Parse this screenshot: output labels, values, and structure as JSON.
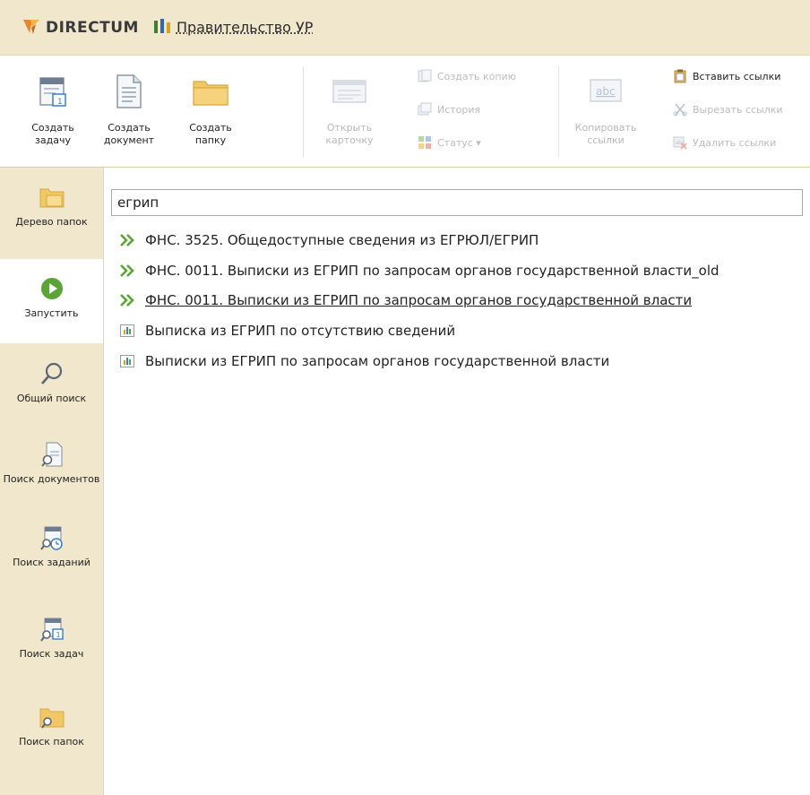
{
  "titlebar": {
    "brand": "DIRECTUM",
    "org": "Правительство УР"
  },
  "ribbon": {
    "create_task": "Создать задачу",
    "create_document": "Создать документ",
    "create_folder": "Создать папку",
    "open_card": "Открыть карточку",
    "create_copy": "Создать копию",
    "history": "История",
    "status": "Статус ▾",
    "copy_links": "Копировать ссылки",
    "paste_links": "Вставить ссылки",
    "cut_links": "Вырезать ссылки",
    "delete_links": "Удалить ссылки"
  },
  "sidebar": {
    "items": [
      {
        "label": "Дерево папок"
      },
      {
        "label": "Запустить"
      },
      {
        "label": "Общий поиск"
      },
      {
        "label": "Поиск документов"
      },
      {
        "label": "Поиск заданий"
      },
      {
        "label": "Поиск задач"
      },
      {
        "label": "Поиск папок"
      }
    ]
  },
  "search": {
    "value": "егрип"
  },
  "results": [
    {
      "icon": "double-chevron-icon",
      "text": "ФНС. 3525. Общедоступные сведения из ЕГРЮЛ/ЕГРИП"
    },
    {
      "icon": "double-chevron-icon",
      "text": "ФНС. 0011. Выписки из ЕГРИП по запросам органов государственной власти_old"
    },
    {
      "icon": "double-chevron-icon",
      "text": "ФНС. 0011. Выписки из ЕГРИП по запросам органов государственной власти"
    },
    {
      "icon": "report-icon",
      "text": "Выписка из ЕГРИП по отсутствию сведений"
    },
    {
      "icon": "report-icon",
      "text": "Выписки из ЕГРИП по запросам органов государственной власти"
    }
  ],
  "colors": {
    "panel_bg": "#f0e7cc",
    "accent_green": "#5aa536",
    "folder_yellow": "#f2c766",
    "brand_orange": "#e8872c"
  }
}
